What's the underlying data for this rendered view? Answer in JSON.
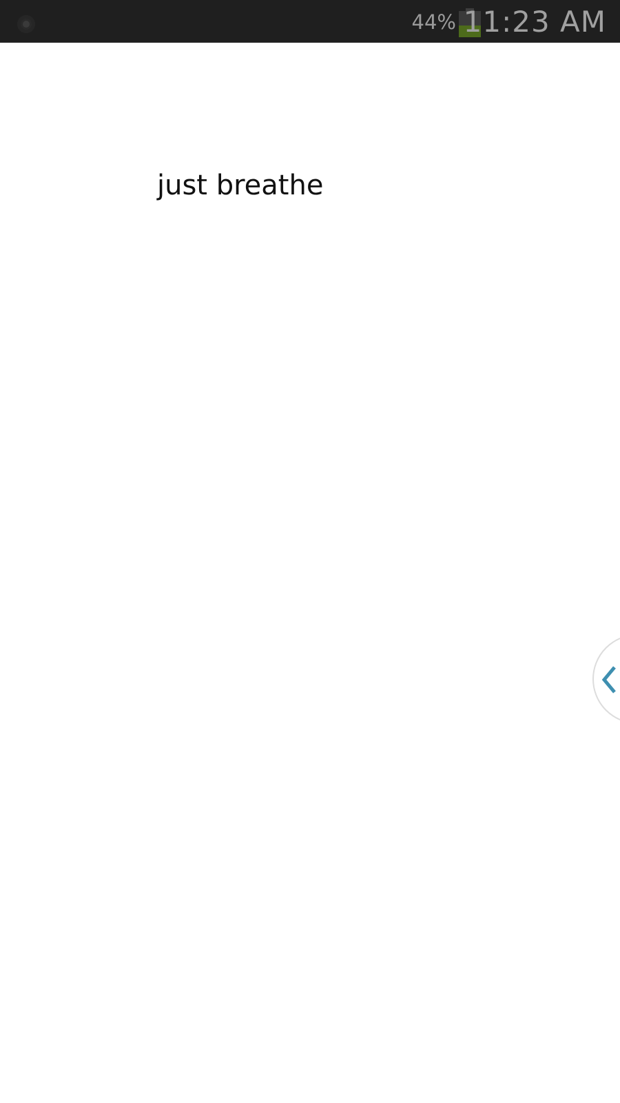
{
  "status_bar": {
    "notification_icon": "notification-dot-icon",
    "battery_percent_label": "44%",
    "battery_level": 0.44,
    "battery_color": "#4d6b1b",
    "time": "11:23 AM"
  },
  "main": {
    "text": "just breathe"
  },
  "side_handle": {
    "icon": "chevron-left-icon",
    "accent_color": "#3e8fb0"
  }
}
